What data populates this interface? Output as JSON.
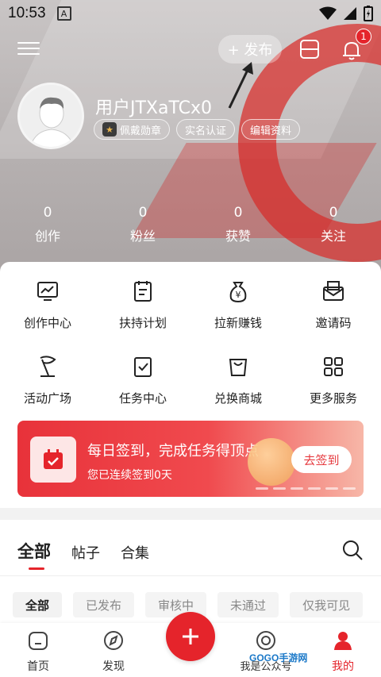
{
  "status_bar": {
    "time": "10:53",
    "notification_letter": "A"
  },
  "toolbar": {
    "publish_label": "+ 发布",
    "notification_count": "1"
  },
  "profile": {
    "username": "用户JTXaTCx0",
    "tags": [
      "佩戴勋章",
      "实名认证",
      "编辑资料"
    ]
  },
  "stats": [
    {
      "value": "0",
      "label": "创作"
    },
    {
      "value": "0",
      "label": "粉丝"
    },
    {
      "value": "0",
      "label": "获赞"
    },
    {
      "value": "0",
      "label": "关注"
    }
  ],
  "services": [
    {
      "label": "创作中心",
      "icon": "monitor-chart-icon"
    },
    {
      "label": "扶持计划",
      "icon": "clipboard-icon"
    },
    {
      "label": "拉新赚钱",
      "icon": "money-bag-icon"
    },
    {
      "label": "邀请码",
      "icon": "invite-mail-icon"
    },
    {
      "label": "活动广场",
      "icon": "flag-icon"
    },
    {
      "label": "任务中心",
      "icon": "task-check-icon"
    },
    {
      "label": "兑换商城",
      "icon": "shopping-bag-icon"
    },
    {
      "label": "更多服务",
      "icon": "grid-icon"
    }
  ],
  "signin_banner": {
    "title": "每日签到，完成任务得顶点",
    "subtitle": "您已连续签到0天",
    "button": "去签到"
  },
  "content_tabs": [
    "全部",
    "帖子",
    "合集"
  ],
  "filter_chips": [
    "全部",
    "已发布",
    "审核中",
    "未通过",
    "仅我可见"
  ],
  "bottom_nav": [
    {
      "label": "首页",
      "icon": "home-icon"
    },
    {
      "label": "发现",
      "icon": "compass-icon"
    },
    {
      "label": "我是公众号",
      "icon": "at-icon"
    },
    {
      "label": "我的",
      "icon": "person-icon"
    }
  ],
  "watermark": "GOGO手游网",
  "colors": {
    "accent": "#e5242b",
    "white": "#ffffff"
  }
}
